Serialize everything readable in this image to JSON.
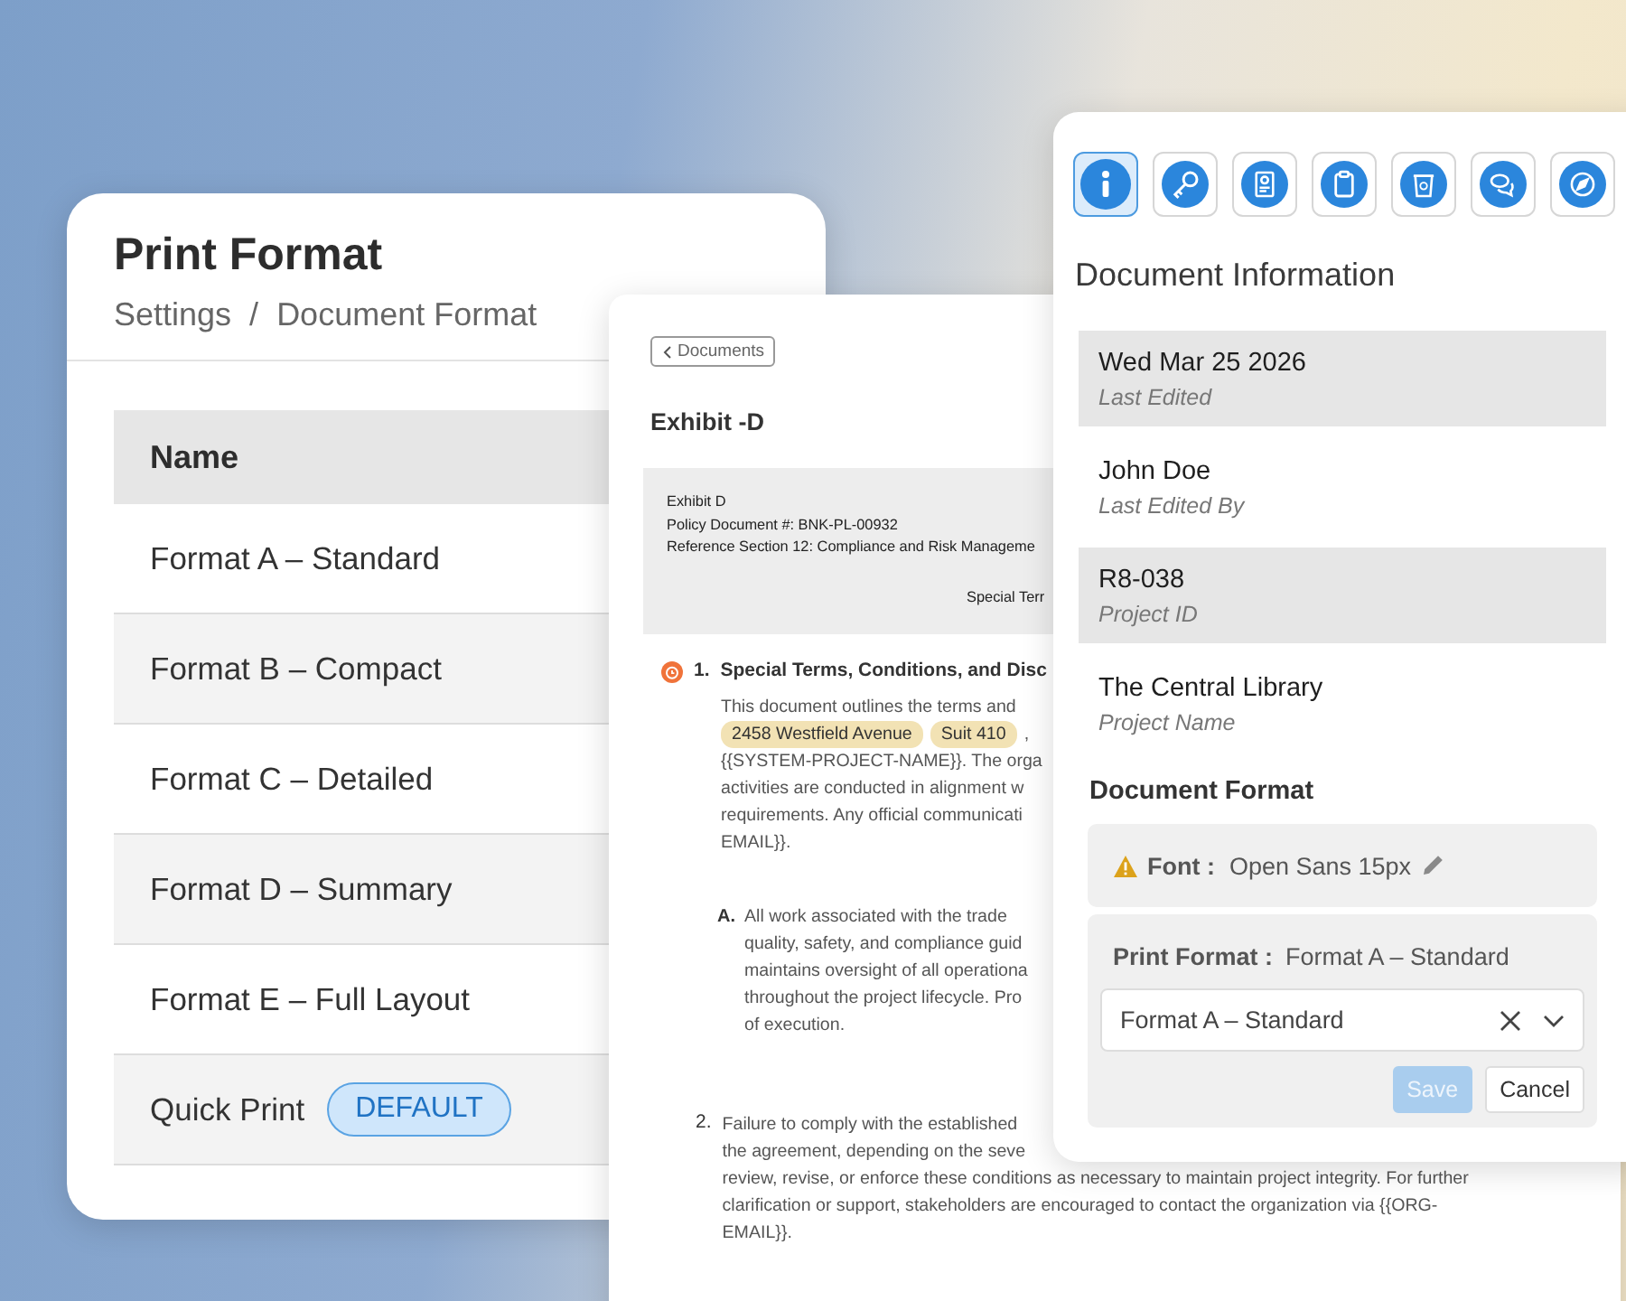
{
  "print_format_card": {
    "title": "Print Format",
    "breadcrumb": [
      "Settings",
      "/",
      "Document Format"
    ],
    "table": {
      "columns": [
        "Name"
      ],
      "rows": [
        {
          "name": "Format A – Standard"
        },
        {
          "name": "Format B – Compact"
        },
        {
          "name": "Format C – Detailed"
        },
        {
          "name": "Format D – Summary"
        },
        {
          "name": "Format E – Full Layout"
        },
        {
          "name": "Quick Print",
          "badge": "DEFAULT"
        }
      ]
    }
  },
  "document": {
    "back_button": "Documents",
    "title": "Exhibit -D",
    "header_lines": [
      "Exhibit D",
      "Policy Document #: BNK-PL-00932",
      "Reference Section 12: Compliance and Risk Manageme"
    ],
    "header_subtitle": "Special Terr",
    "sections": [
      {
        "number": "1.",
        "heading": "Special Terms, Conditions, and Disc",
        "lines": [
          {
            "text": "This document outlines the terms and"
          },
          {
            "chips": [
              "2458 Westfield Avenue",
              "Suit 410"
            ],
            "after": ","
          },
          {
            "text": "{{SYSTEM-PROJECT-NAME}}. The orga"
          },
          {
            "text": "activities are conducted in alignment w"
          },
          {
            "text": "requirements. Any official communicati"
          },
          {
            "text": "EMAIL}}."
          }
        ],
        "items": [
          {
            "marker": "A.",
            "lines": [
              "All work associated with the trade",
              "quality, safety, and compliance guid",
              "maintains oversight of all operationa",
              "throughout the project lifecycle. Pro",
              "of execution."
            ]
          }
        ]
      },
      {
        "number": "2.",
        "lines": [
          {
            "text": "Failure to comply with the established"
          },
          {
            "text": "the agreement, depending on the seve"
          },
          {
            "text": "review, revise, or enforce these conditions as necessary to maintain project integrity. For further"
          },
          {
            "text": "clarification or support, stakeholders are encouraged to contact the organization via {{ORG-"
          },
          {
            "text": "EMAIL}}."
          }
        ]
      }
    ]
  },
  "info_panel": {
    "toolbar": [
      {
        "kind": "info",
        "selected": true
      },
      {
        "kind": "key",
        "selected": false
      },
      {
        "kind": "document",
        "selected": false
      },
      {
        "kind": "clipboard",
        "selected": false
      },
      {
        "kind": "bin",
        "selected": false
      },
      {
        "kind": "chat",
        "selected": false
      },
      {
        "kind": "compass",
        "selected": false
      }
    ],
    "title": "Document Information",
    "fields": [
      {
        "value": "Wed Mar 25 2026",
        "label": "Last Edited"
      },
      {
        "value": "John Doe",
        "label": "Last Edited By"
      },
      {
        "value": "R8-038",
        "label": "Project ID"
      },
      {
        "value": "The Central Library",
        "label": "Project Name"
      }
    ],
    "format_title": "Document Format",
    "font": {
      "label": "Font :",
      "value": "Open Sans 15px",
      "warning": true
    },
    "print_format": {
      "label": "Print Format :",
      "value": "Format A – Standard",
      "select_value": "Format A – Standard"
    },
    "buttons": [
      {
        "label": "Save",
        "disabled": true
      },
      {
        "label": "Cancel",
        "disabled": false
      }
    ]
  }
}
